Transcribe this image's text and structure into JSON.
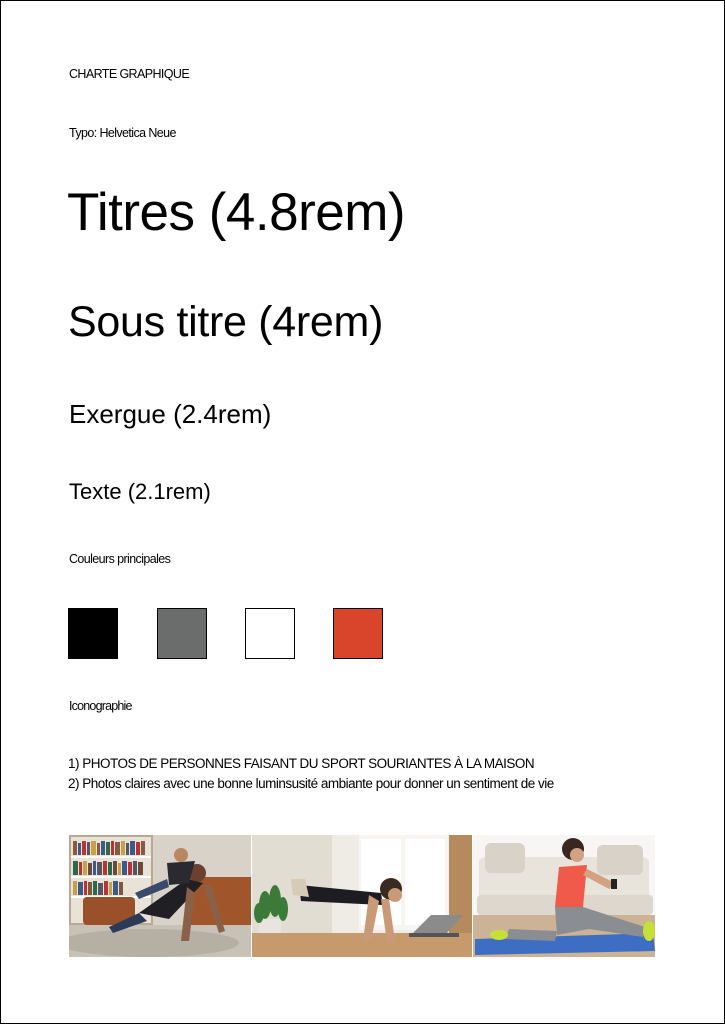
{
  "header": {
    "title": "CHARTE GRAPHIQUE"
  },
  "typography": {
    "font_label": "Typo: Helvetica Neue",
    "titres": "Titres (4.8rem)",
    "sous_titre": "Sous titre (4rem)",
    "exergue": "Exergue (2.4rem)",
    "texte": "Texte (2.1rem)"
  },
  "colors": {
    "label": "Couleurs principales",
    "swatches": [
      "#000000",
      "#6b6c6c",
      "#ffffff",
      "#d9452a"
    ]
  },
  "iconography": {
    "label": "Iconographie",
    "line1": "1) PHOTOS DE PERSONNES FAISANT DU SPORT SOURIANTES À LA MAISON",
    "line2": "2) Photos claires avec une bonne luminsusité ambiante pour donner un sentiment de vie"
  }
}
